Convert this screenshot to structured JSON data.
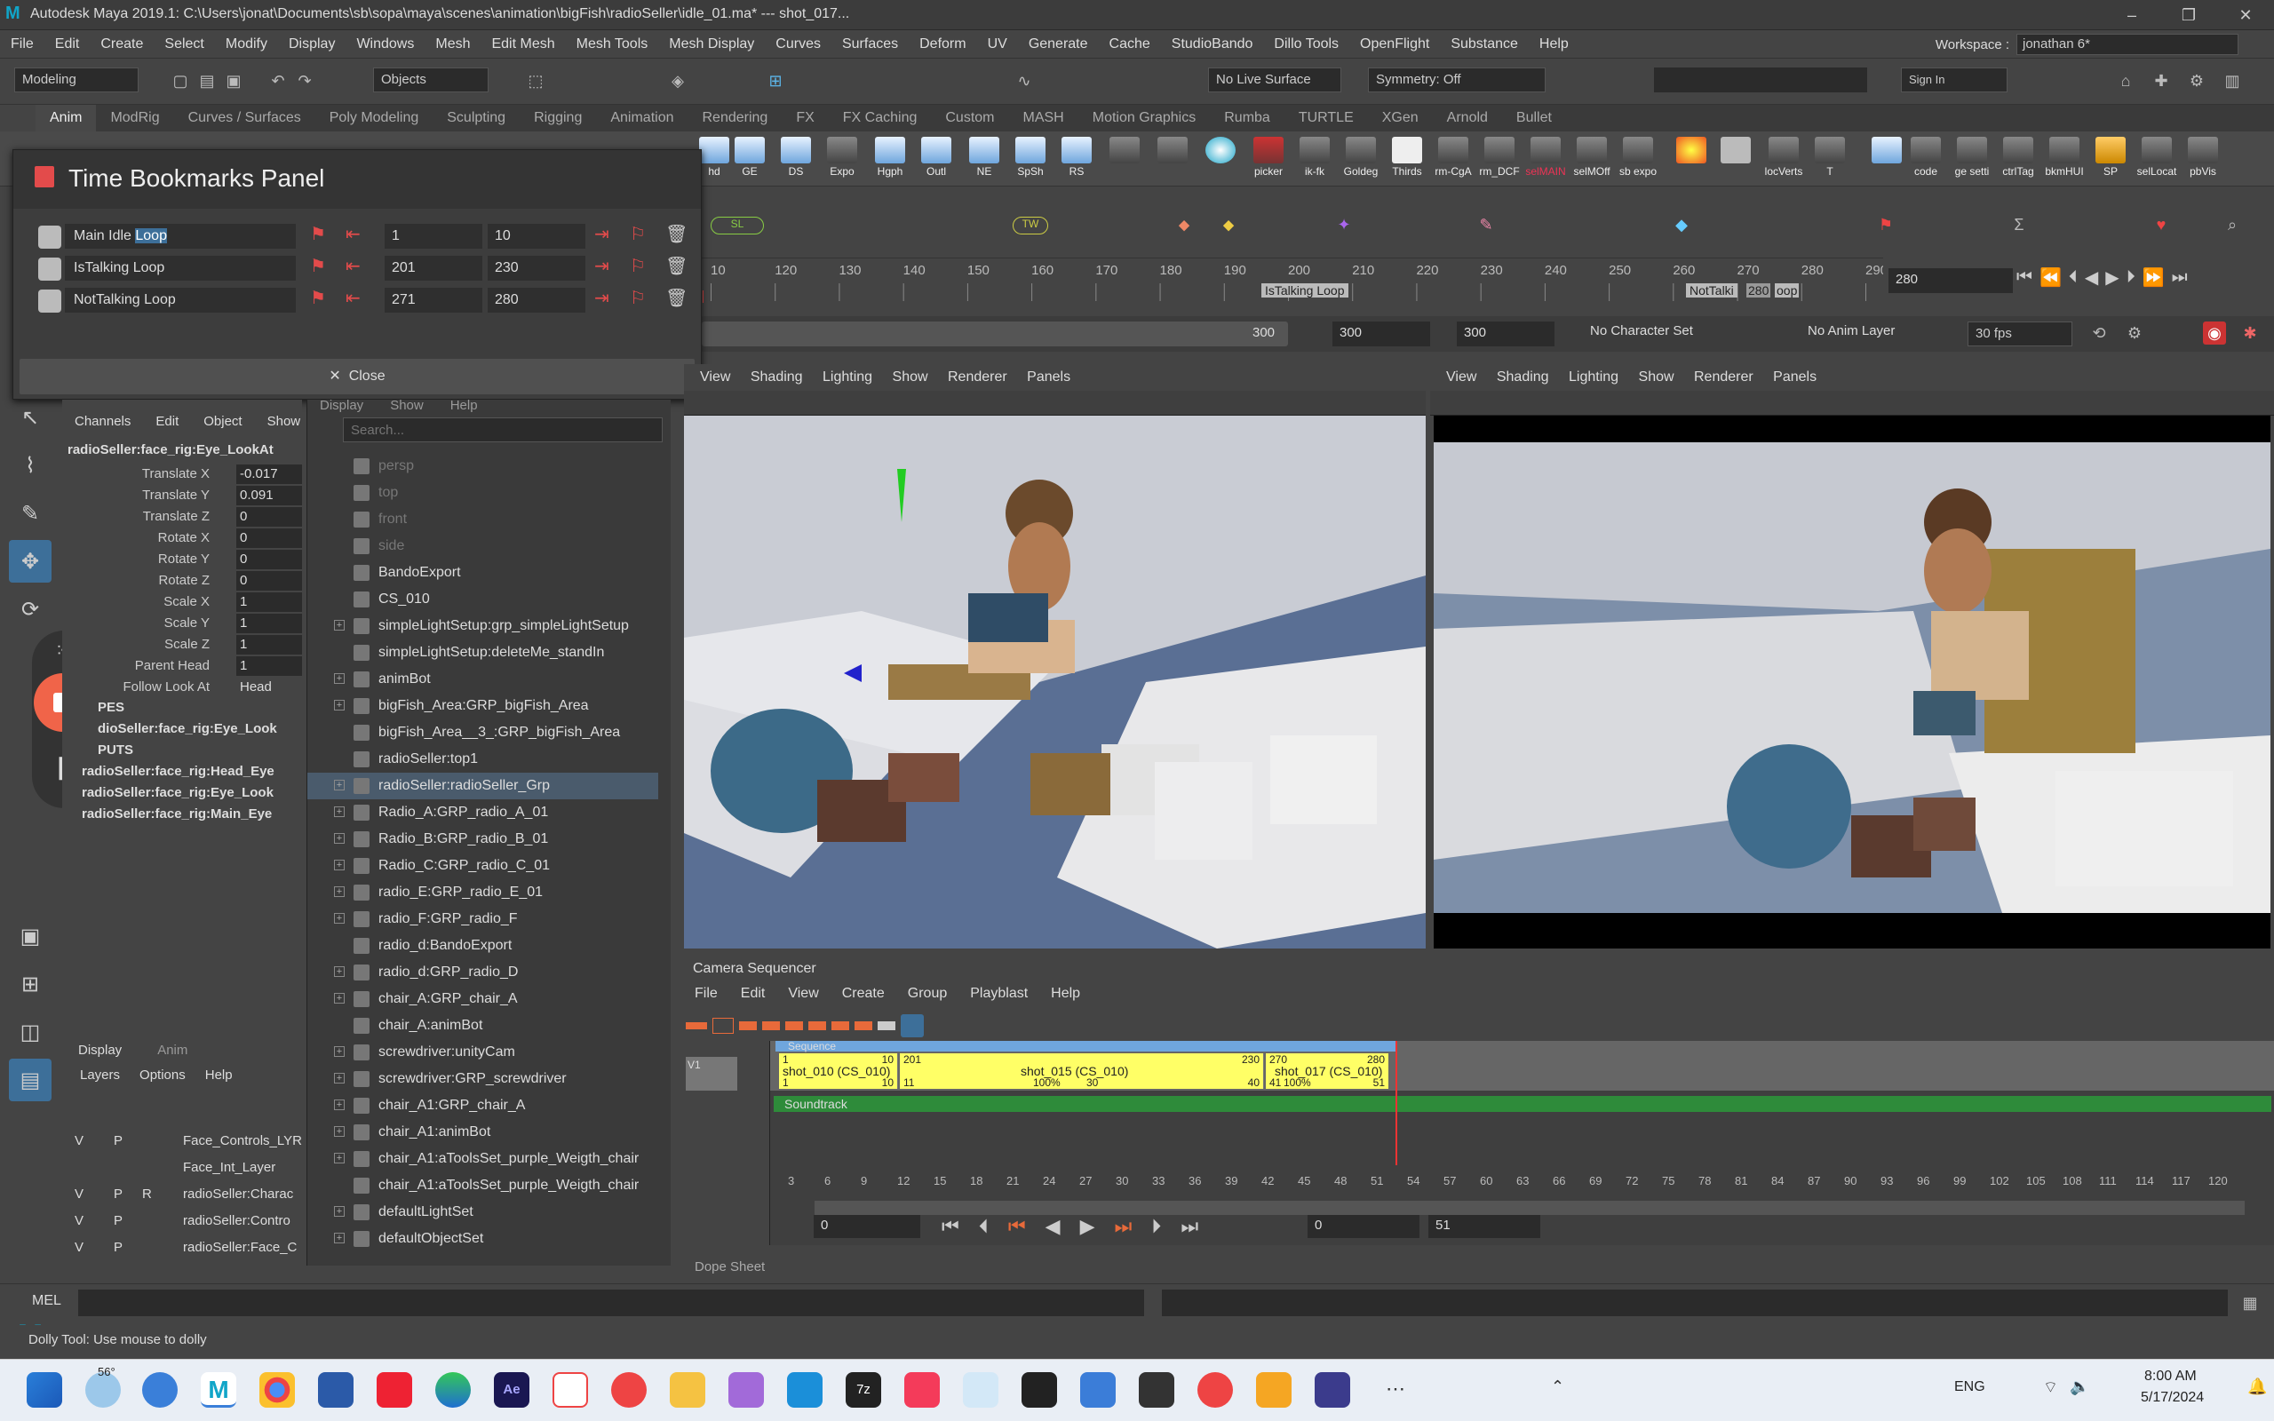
{
  "window": {
    "app_logo": "M",
    "title": "Autodesk Maya 2019.1: C:\\Users\\jonat\\Documents\\sb\\sopa\\maya\\scenes\\animation\\bigFish\\radioSeller\\idle_01.ma*   ---   shot_017...",
    "controls": [
      "–",
      "❐",
      "✕"
    ]
  },
  "menubar": {
    "items": [
      "File",
      "Edit",
      "Create",
      "Select",
      "Modify",
      "Display",
      "Windows",
      "Mesh",
      "Edit Mesh",
      "Mesh Tools",
      "Mesh Display",
      "Curves",
      "Surfaces",
      "Deform",
      "UV",
      "Generate",
      "Cache",
      "StudioBando",
      "Dillo Tools",
      "OpenFlight",
      "Substance",
      "Help"
    ],
    "workspace_label": "Workspace :",
    "workspace_value": "jonathan 6*"
  },
  "statusline": {
    "mode": "Modeling",
    "objects": "Objects",
    "live_surface": "No Live Surface",
    "symmetry": "Symmetry: Off",
    "sign_in": "Sign In"
  },
  "shelf_tabs": [
    "Anim",
    "ModRig",
    "Curves / Surfaces",
    "Poly Modeling",
    "Sculpting",
    "Rigging",
    "Animation",
    "Rendering",
    "FX",
    "FX Caching",
    "Custom",
    "MASH",
    "Motion Graphics",
    "Rumba",
    "TURTLE",
    "XGen",
    "Arnold",
    "Bullet"
  ],
  "shelf_buttons": [
    "hd",
    "GE",
    "DS",
    "Expo",
    "Hgph",
    "Outl",
    "NE",
    "SpSh",
    "RS",
    "",
    "",
    "",
    "picker",
    "ik-fk",
    "Goldeg",
    "Thirds",
    "rm-CgA",
    "rm_DCF",
    "selMAIN",
    "selMOff",
    "sb expo",
    "",
    "",
    "locVerts",
    "T",
    "",
    "code",
    "ge setti",
    "ctrlTag",
    "bkmHUI",
    "SP",
    "selLocat",
    "pbVis"
  ],
  "bookmarks_panel": {
    "title": "Time Bookmarks Panel",
    "rows": [
      {
        "name": "Main Idle",
        "highlight": "Loop",
        "start": "1",
        "end": "10"
      },
      {
        "name": "IsTalking Loop",
        "highlight": "",
        "start": "201",
        "end": "230"
      },
      {
        "name": "NotTalking Loop",
        "highlight": "",
        "start": "271",
        "end": "280"
      }
    ],
    "close_label": "Close"
  },
  "timeline": {
    "ticks": [
      "10",
      "120",
      "130",
      "140",
      "150",
      "160",
      "170",
      "180",
      "190",
      "200",
      "210",
      "220",
      "230",
      "240",
      "250",
      "260",
      "270",
      "280",
      "290"
    ],
    "current_frame": "280",
    "bookmark_labels": [
      "IsTalking Loop",
      "NotTalki",
      "280",
      "oop"
    ],
    "range_end": "300",
    "range_a": "300",
    "range_b": "300",
    "character_set": "No Character Set",
    "anim_layer": "No Anim Layer",
    "fps": "30 fps"
  },
  "channel_box": {
    "menus": [
      "Channels",
      "Edit",
      "Object",
      "Show"
    ],
    "node": "radioSeller:face_rig:Eye_LookAt",
    "channels": [
      {
        "label": "Translate X",
        "value": "-0.017"
      },
      {
        "label": "Translate Y",
        "value": "0.091"
      },
      {
        "label": "Translate Z",
        "value": "0"
      },
      {
        "label": "Rotate X",
        "value": "0"
      },
      {
        "label": "Rotate Y",
        "value": "0"
      },
      {
        "label": "Rotate Z",
        "value": "0"
      },
      {
        "label": "Scale X",
        "value": "1"
      },
      {
        "label": "Scale Y",
        "value": "1"
      },
      {
        "label": "Scale Z",
        "value": "1"
      },
      {
        "label": "Parent Head",
        "value": "1"
      },
      {
        "label": "Follow Look At",
        "value": "Head"
      }
    ],
    "shapes_label": "PES",
    "shape_node": "dioSeller:face_rig:Eye_Look",
    "inputs_label": "PUTS",
    "inputs": [
      "radioSeller:face_rig:Head_Eye",
      "radioSeller:face_rig:Eye_Look",
      "radioSeller:face_rig:Main_Eye"
    ]
  },
  "layer_editor": {
    "tabs": [
      "Display",
      "Anim"
    ],
    "menus": [
      "Layers",
      "Options",
      "Help"
    ],
    "layers": [
      {
        "v": "V",
        "p": "P",
        "r": "",
        "name": "Face_Controls_LYR"
      },
      {
        "v": "",
        "p": "",
        "r": "",
        "name": "Face_Int_Layer"
      },
      {
        "v": "V",
        "p": "P",
        "r": "R",
        "name": "radioSeller:Charac"
      },
      {
        "v": "V",
        "p": "P",
        "r": "",
        "name": "radioSeller:Contro"
      },
      {
        "v": "V",
        "p": "P",
        "r": "",
        "name": "radioSeller:Face_C"
      }
    ]
  },
  "outliner": {
    "menus": [
      "Display",
      "Show",
      "Help"
    ],
    "search_placeholder": "Search...",
    "items": [
      "persp",
      "top",
      "front",
      "side",
      "BandoExport",
      "CS_010",
      "simpleLightSetup:grp_simpleLightSetup",
      "simpleLightSetup:deleteMe_standIn",
      "animBot",
      "bigFish_Area:GRP_bigFish_Area",
      "bigFish_Area__3_:GRP_bigFish_Area",
      "radioSeller:top1",
      "radioSeller:radioSeller_Grp",
      "Radio_A:GRP_radio_A_01",
      "Radio_B:GRP_radio_B_01",
      "Radio_C:GRP_radio_C_01",
      "radio_E:GRP_radio_E_01",
      "radio_F:GRP_radio_F",
      "radio_d:BandoExport",
      "radio_d:GRP_radio_D",
      "chair_A:GRP_chair_A",
      "chair_A:animBot",
      "screwdriver:unityCam",
      "screwdriver:GRP_screwdriver",
      "chair_A1:GRP_chair_A",
      "chair_A1:animBot",
      "chair_A1:aToolsSet_purple_Weigth_chair",
      "chair_A1:aToolsSet_purple_Weigth_chair",
      "defaultLightSet",
      "defaultObjectSet"
    ]
  },
  "viewport_left": {
    "menus": [
      "View",
      "Shading",
      "Lighting",
      "Show",
      "Renderer",
      "Panels"
    ]
  },
  "viewport_right": {
    "menus": [
      "View",
      "Shading",
      "Lighting",
      "Show",
      "Renderer",
      "Panels"
    ]
  },
  "camera_sequencer": {
    "title": "Camera Sequencer",
    "menus": [
      "File",
      "Edit",
      "View",
      "Create",
      "Group",
      "Playblast",
      "Help"
    ],
    "track_label": "V1",
    "sequence_label": "Sequence",
    "soundtrack_label": "Soundtrack",
    "shots": [
      {
        "name": "shot_010 (CS_010)",
        "start": "1",
        "end": "10",
        "start_b": "1",
        "end_b": "10"
      },
      {
        "name": "shot_015 (CS_010)",
        "start": "201",
        "end": "230",
        "start_b": "11",
        "end_b": "40",
        "scale": "100%",
        "mid": "30"
      },
      {
        "name": "shot_017 (CS_010)",
        "start": "270",
        "end": "280",
        "start_b": "41",
        "end_b": "51",
        "scale": "100%"
      }
    ],
    "ruler": [
      "3",
      "6",
      "9",
      "12",
      "15",
      "18",
      "21",
      "24",
      "27",
      "30",
      "33",
      "36",
      "39",
      "42",
      "45",
      "48",
      "51",
      "54",
      "57",
      "60",
      "63",
      "66",
      "69",
      "72",
      "75",
      "78",
      "81",
      "84",
      "87",
      "90",
      "93",
      "96",
      "99",
      "102",
      "105",
      "108",
      "111",
      "114",
      "117",
      "120"
    ],
    "range_start": "0",
    "range_a": "0",
    "range_b": "51",
    "dope_sheet_label": "Dope Sheet"
  },
  "command_line": {
    "label": "MEL"
  },
  "help_line": {
    "text": "Dolly Tool: Use mouse to dolly"
  },
  "taskbar": {
    "weather": "56°",
    "lang": "ENG",
    "time": "8:00 AM",
    "date": "5/17/2024"
  },
  "colors": {
    "maya_bg": "#444444",
    "selection_blue": "#3d6f99",
    "bookmark_red": "#e34b4b",
    "shot_yellow": "#ffff66",
    "soundtrack_green": "#2e8b3a",
    "sequence_blue": "#6fa6dd",
    "record_orange": "#f06449"
  }
}
